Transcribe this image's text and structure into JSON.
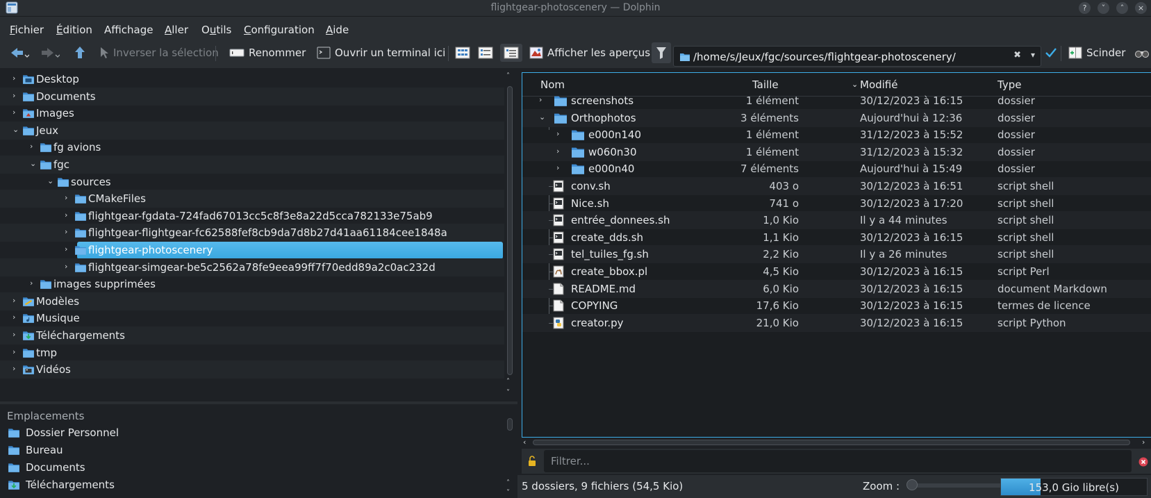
{
  "window": {
    "title": "flightgear-photoscenery — Dolphin",
    "help_btn": "?",
    "min_btn": "˅",
    "max_btn": "˄",
    "close_btn": "×"
  },
  "menu": [
    {
      "acc": "F",
      "rest": "ichier"
    },
    {
      "acc": "É",
      "rest": "dition"
    },
    {
      "pre": "Afficha",
      "acc": "g",
      "rest": "e"
    },
    {
      "acc": "A",
      "rest": "ller"
    },
    {
      "pre": "O",
      "acc": "u",
      "rest": "tils",
      "under_pre": false
    },
    {
      "acc": "C",
      "rest": "onfiguration"
    },
    {
      "acc": "A",
      "rest": "ide"
    }
  ],
  "toolbar": {
    "invert_selection": "Inverser la sélection",
    "rename": "Renommer",
    "open_terminal": "Ouvrir un terminal ici",
    "show_previews": "Afficher les aperçus",
    "split": "Scinder"
  },
  "location": {
    "path": "/home/s/Jeux/fgc/sources/flightgear-photoscenery/"
  },
  "tree": [
    {
      "label": "Desktop",
      "depth": 0,
      "expanded": false,
      "icon": "desktop-folder-icon"
    },
    {
      "label": "Documents",
      "depth": 0,
      "expanded": false,
      "icon": "folder-icon"
    },
    {
      "label": "Images",
      "depth": 0,
      "expanded": false,
      "icon": "pictures-folder-icon"
    },
    {
      "label": "Jeux",
      "depth": 0,
      "expanded": true,
      "icon": "folder-icon"
    },
    {
      "label": "fg avions",
      "depth": 1,
      "expanded": false,
      "icon": "folder-icon"
    },
    {
      "label": "fgc",
      "depth": 1,
      "expanded": true,
      "icon": "folder-icon"
    },
    {
      "label": "sources",
      "depth": 2,
      "expanded": true,
      "icon": "folder-icon"
    },
    {
      "label": "CMakeFiles",
      "depth": 3,
      "expanded": false,
      "icon": "folder-icon"
    },
    {
      "label": "flightgear-fgdata-724fad67013cc5c8f3e8a22d5cca782133e75ab9",
      "depth": 3,
      "expanded": false,
      "icon": "folder-icon"
    },
    {
      "label": "flightgear-flightgear-fc62588fef8cb9da7d8b27d41aa61184cee1848a",
      "depth": 3,
      "expanded": false,
      "icon": "folder-icon"
    },
    {
      "label": "flightgear-photoscenery",
      "depth": 3,
      "expanded": false,
      "icon": "folder-icon",
      "selected": true
    },
    {
      "label": "flightgear-simgear-be5c2562a78fe9eea99ff7f70edd89a2c0ac232d",
      "depth": 3,
      "expanded": false,
      "icon": "folder-icon"
    },
    {
      "label": "images supprimées",
      "depth": 1,
      "expanded": false,
      "icon": "folder-icon"
    },
    {
      "label": "Modèles",
      "depth": 0,
      "expanded": false,
      "icon": "templates-folder-icon"
    },
    {
      "label": "Musique",
      "depth": 0,
      "expanded": false,
      "icon": "music-folder-icon"
    },
    {
      "label": "Téléchargements",
      "depth": 0,
      "expanded": false,
      "icon": "downloads-folder-icon"
    },
    {
      "label": "tmp",
      "depth": 0,
      "expanded": false,
      "icon": "folder-icon"
    },
    {
      "label": "Vidéos",
      "depth": 0,
      "expanded": false,
      "icon": "videos-folder-icon"
    }
  ],
  "places": {
    "title": "Emplacements",
    "items": [
      {
        "label": "Dossier Personnel",
        "icon": "home-folder-icon"
      },
      {
        "label": "Bureau",
        "icon": "desktop-icon"
      },
      {
        "label": "Documents",
        "icon": "folder-icon"
      },
      {
        "label": "Téléchargements",
        "icon": "downloads-folder-icon"
      }
    ]
  },
  "columns": {
    "name": "Nom",
    "size": "Taille",
    "modified": "Modifié",
    "type": "Type"
  },
  "files": [
    {
      "name": "screenshots",
      "size": "1 élément",
      "modified": "30/12/2023 à 16:15",
      "type": "dossier",
      "depth": 0,
      "kind": "folder",
      "chevron": "closed"
    },
    {
      "name": "Orthophotos",
      "size": "3 éléments",
      "modified": "Aujourd'hui à 12:36",
      "type": "dossier",
      "depth": 0,
      "kind": "folder",
      "chevron": "open"
    },
    {
      "name": "e000n140",
      "size": "1 élément",
      "modified": "31/12/2023 à 15:52",
      "type": "dossier",
      "depth": 1,
      "kind": "folder",
      "chevron": "closed"
    },
    {
      "name": "w060n30",
      "size": "1 élément",
      "modified": "31/12/2023 à 15:32",
      "type": "dossier",
      "depth": 1,
      "kind": "folder",
      "chevron": "closed"
    },
    {
      "name": "e000n40",
      "size": "7 éléments",
      "modified": "Aujourd'hui à 15:49",
      "type": "dossier",
      "depth": 1,
      "kind": "folder",
      "chevron": "closed"
    },
    {
      "name": "conv.sh",
      "size": "403 o",
      "modified": "30/12/2023 à 16:51",
      "type": "script shell",
      "depth": 0,
      "kind": "shell"
    },
    {
      "name": "Nice.sh",
      "size": "741 o",
      "modified": "30/12/2023 à 17:20",
      "type": "script shell",
      "depth": 0,
      "kind": "shell"
    },
    {
      "name": "entrée_donnees.sh",
      "size": "1,0 Kio",
      "modified": "Il y a 44 minutes",
      "type": "script shell",
      "depth": 0,
      "kind": "shell"
    },
    {
      "name": "create_dds.sh",
      "size": "1,1 Kio",
      "modified": "30/12/2023 à 16:15",
      "type": "script shell",
      "depth": 0,
      "kind": "shell"
    },
    {
      "name": "tel_tuiles_fg.sh",
      "size": "2,2 Kio",
      "modified": "Il y a 26 minutes",
      "type": "script shell",
      "depth": 0,
      "kind": "shell"
    },
    {
      "name": "create_bbox.pl",
      "size": "4,5 Kio",
      "modified": "30/12/2023 à 16:15",
      "type": "script Perl",
      "depth": 0,
      "kind": "perl"
    },
    {
      "name": "README.md",
      "size": "6,0 Kio",
      "modified": "30/12/2023 à 16:15",
      "type": "document Markdown",
      "depth": 0,
      "kind": "text"
    },
    {
      "name": "COPYING",
      "size": "17,6 Kio",
      "modified": "30/12/2023 à 16:15",
      "type": "termes de licence",
      "depth": 0,
      "kind": "text"
    },
    {
      "name": "creator.py",
      "size": "21,0 Kio",
      "modified": "30/12/2023 à 16:15",
      "type": "script Python",
      "depth": 0,
      "kind": "python"
    }
  ],
  "filter": {
    "placeholder": "Filtrer..."
  },
  "status": {
    "summary": "5 dossiers, 9 fichiers (54,5 Kio)",
    "zoom_label": "Zoom :",
    "free_space": "153,0 Gio libre(s)",
    "used_fraction": 0.27
  },
  "colors": {
    "accent": "#3daee9",
    "background": "#1e2125",
    "toolbar": "#2a2e32"
  }
}
